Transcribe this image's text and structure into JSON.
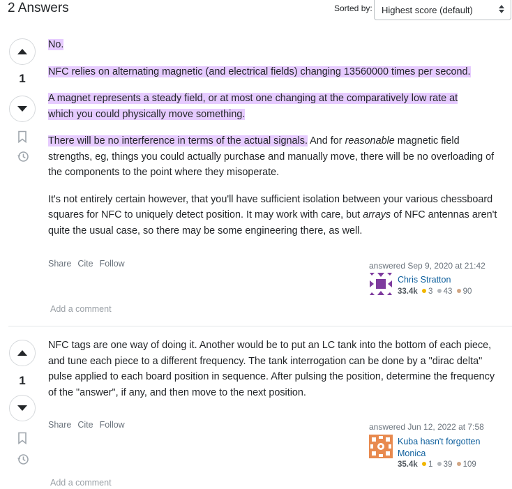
{
  "header": {
    "answers_count": "2 Answers",
    "sorted_by_label": "Sorted by:",
    "sort_selected": "Highest score (default)"
  },
  "colors": {
    "highlight": "#e6cbff",
    "link": "#0c5e9c",
    "gold": "#f1b600",
    "silver": "#b4b8bc",
    "bronze": "#d1a684"
  },
  "answers": [
    {
      "score": "1",
      "paragraphs": [
        {
          "segments": [
            {
              "text": "No.",
              "hl": true
            }
          ]
        },
        {
          "segments": [
            {
              "text": "NFC relies on alternating magnetic (and electrical fields) changing 13560000 times per second.",
              "hl": true
            }
          ]
        },
        {
          "segments": [
            {
              "text": "A magnet represents a steady field, or at most one changing at the comparatively low rate at which you could physically move something.",
              "hl": true
            }
          ]
        },
        {
          "segments": [
            {
              "text": "There will be no interference in terms of the actual signals.",
              "hl": true
            },
            {
              "text": " And for "
            },
            {
              "text": "reasonable",
              "em": true
            },
            {
              "text": " magnetic field strengths, eg, things you could actually purchase and manually move, there will be no overloading of the components to the point where they misoperate."
            }
          ]
        },
        {
          "segments": [
            {
              "text": "It's not entirely certain however, that you'll have sufficient isolation between your various chessboard squares for NFC to uniquely detect position. It may work with care, but "
            },
            {
              "text": "arrays",
              "em": true
            },
            {
              "text": " of NFC antennas aren't quite the usual case, so there may be some engineering there, as well."
            }
          ]
        }
      ],
      "menu": {
        "share": "Share",
        "cite": "Cite",
        "follow": "Follow"
      },
      "answered": "answered Sep 9, 2020 at 21:42",
      "user": {
        "name": "Chris Stratton",
        "rep": "33.4k",
        "gold": "3",
        "silver": "43",
        "bronze": "90",
        "avatar_color": "#7e3b9e",
        "avatar_icon": "identicon"
      },
      "add_comment": "Add a comment"
    },
    {
      "score": "1",
      "paragraphs": [
        {
          "segments": [
            {
              "text": "NFC tags are one way of doing it. Another would be to put an LC tank into the bottom of each piece, and tune each piece to a different frequency. The tank interrogation can be done by a \"dirac delta\" pulse applied to each board position in sequence. After pulsing the position, determine the frequency of the \"answer\", if any, and then move to the next position."
            }
          ]
        }
      ],
      "menu": {
        "share": "Share",
        "cite": "Cite",
        "follow": "Follow"
      },
      "answered": "answered Jun 12, 2022 at 7:58",
      "user": {
        "name": "Kuba hasn't forgotten Monica",
        "rep": "35.4k",
        "gold": "1",
        "silver": "39",
        "bronze": "109",
        "avatar_color": "#e88a4f",
        "avatar_icon": "identicon"
      },
      "add_comment": "Add a comment"
    }
  ],
  "icons": {
    "upvote": "arrow-up-icon",
    "downvote": "arrow-down-icon",
    "bookmark": "bookmark-icon",
    "history": "history-icon",
    "sort": "sort-arrows-icon"
  }
}
